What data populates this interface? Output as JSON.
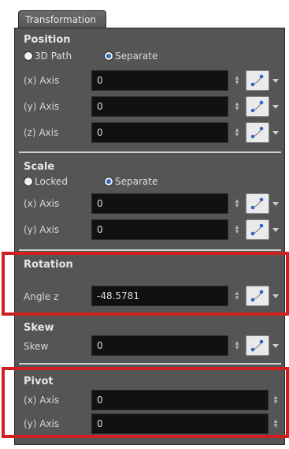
{
  "tab": {
    "label": "Transformation"
  },
  "position": {
    "title": "Position",
    "radio": {
      "option1": "3D Path",
      "option2": "Separate",
      "selected": "Separate"
    },
    "rows": [
      {
        "label": "(x) Axis",
        "value": "0"
      },
      {
        "label": "(y) Axis",
        "value": "0"
      },
      {
        "label": "(z) Axis",
        "value": "0"
      }
    ]
  },
  "scale": {
    "title": "Scale",
    "radio": {
      "option1": "Locked",
      "option2": "Separate",
      "selected": "Separate"
    },
    "rows": [
      {
        "label": "(x) Axis",
        "value": "0"
      },
      {
        "label": "(y) Axis",
        "value": "0"
      }
    ]
  },
  "rotation": {
    "title": "Rotation",
    "rows": [
      {
        "label": "Angle z",
        "value": "-48.5781"
      }
    ]
  },
  "skew": {
    "title": "Skew",
    "rows": [
      {
        "label": "Skew",
        "value": "0"
      }
    ]
  },
  "pivot": {
    "title": "Pivot",
    "rows": [
      {
        "label": "(x) Axis",
        "value": "0"
      },
      {
        "label": "(y) Axis",
        "value": "0"
      }
    ]
  },
  "colors": {
    "panel_bg": "#555555",
    "field_bg": "#111111",
    "highlight": "#d01f1f",
    "radio_dot": "#2f6dbd"
  },
  "icons": {
    "function_button": "bezier-curve-icon",
    "spinner": "up-down-arrows-icon",
    "dropdown": "triangle-down-icon"
  }
}
